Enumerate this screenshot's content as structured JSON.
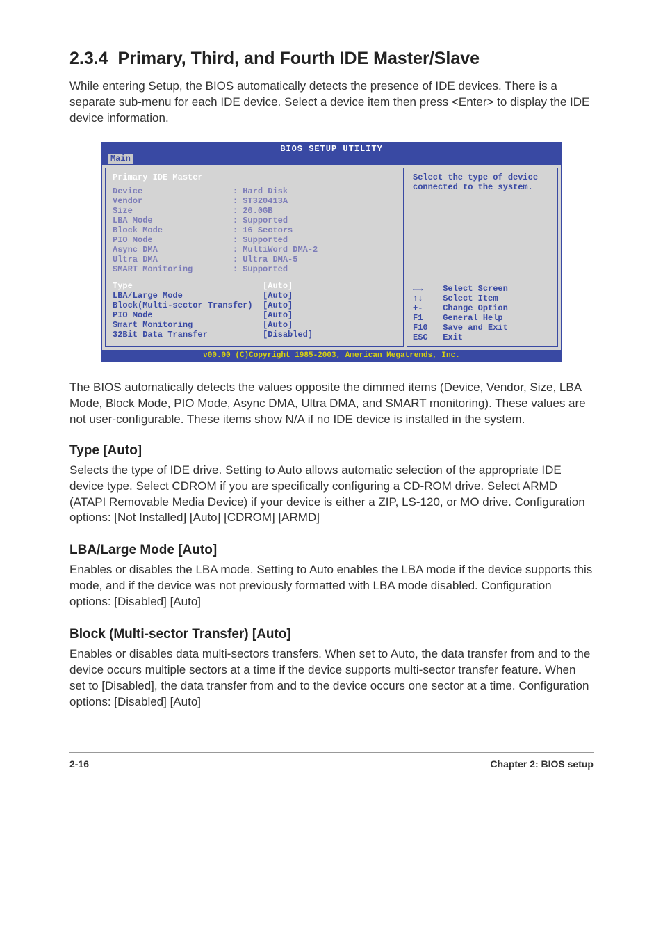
{
  "section": {
    "number": "2.3.4",
    "title": "Primary, Third, and Fourth IDE Master/Slave",
    "intro": "While entering Setup, the BIOS automatically detects the presence of IDE devices. There is a separate sub-menu for each IDE device. Select a device item then press <Enter> to display the IDE device information."
  },
  "bios": {
    "title": "BIOS SETUP UTILITY",
    "tab": "Main",
    "panel_header": "Primary IDE Master",
    "info_rows": [
      {
        "label": "Device",
        "value": "Hard Disk"
      },
      {
        "label": "Vendor",
        "value": "ST320413A"
      },
      {
        "label": "Size",
        "value": "20.0GB"
      },
      {
        "label": "LBA Mode",
        "value": "Supported"
      },
      {
        "label": "Block Mode",
        "value": "16 Sectors"
      },
      {
        "label": "PIO Mode",
        "value": "Supported"
      },
      {
        "label": "Async DMA",
        "value": "MultiWord DMA-2"
      },
      {
        "label": "Ultra DMA",
        "value": "Ultra DMA-5"
      },
      {
        "label": "SMART Monitoring",
        "value": "Supported"
      }
    ],
    "config_rows": [
      {
        "label": "Type",
        "value": "[Auto]",
        "first": true
      },
      {
        "label": "LBA/Large Mode",
        "value": "[Auto]"
      },
      {
        "label": "Block(Multi-sector Transfer)",
        "value": "[Auto]"
      },
      {
        "label": "PIO Mode",
        "value": "[Auto]"
      },
      {
        "label": "Smart Monitoring",
        "value": "[Auto]"
      },
      {
        "label": "32Bit Data Transfer",
        "value": "[Disabled]"
      }
    ],
    "help_text": "Select the type of device connected to the system.",
    "nav": [
      {
        "key": "←→",
        "label": "Select Screen"
      },
      {
        "key": "↑↓",
        "label": "Select Item"
      },
      {
        "key": "+-",
        "label": "Change Option"
      },
      {
        "key": "F1",
        "label": "General Help"
      },
      {
        "key": "F10",
        "label": "Save and Exit"
      },
      {
        "key": "ESC",
        "label": "Exit"
      }
    ],
    "footer": "v00.00 (C)Copyright 1985-2003, American Megatrends, Inc."
  },
  "post_bios_para": "The BIOS automatically detects the values opposite the dimmed items (Device, Vendor, Size, LBA Mode, Block Mode, PIO Mode, Async DMA, Ultra DMA, and SMART monitoring). These values are not user-configurable. These items show N/A if no IDE device is installed in the system.",
  "type_section": {
    "title": "Type [Auto]",
    "body": "Selects the type of IDE drive. Setting to Auto allows automatic selection of the appropriate IDE device type. Select CDROM if you are specifically configuring a CD-ROM drive. Select ARMD (ATAPI Removable Media Device) if your device is either a ZIP, LS-120, or MO drive. Configuration options: [Not Installed] [Auto] [CDROM] [ARMD]"
  },
  "lba_section": {
    "title": "LBA/Large Mode [Auto]",
    "body": "Enables or disables the LBA mode. Setting to Auto enables the LBA mode if the device supports this mode, and if the device was not previously formatted with LBA mode disabled. Configuration options: [Disabled] [Auto]"
  },
  "block_section": {
    "title": "Block (Multi-sector Transfer) [Auto]",
    "body": "Enables or disables data multi-sectors transfers. When set to Auto, the data transfer from and to the device occurs multiple sectors at a time if the device supports multi-sector transfer feature. When set to [Disabled], the data transfer from and to the device occurs one sector at a time. Configuration options: [Disabled] [Auto]"
  },
  "footer": {
    "left": "2-16",
    "right": "Chapter 2: BIOS setup"
  }
}
